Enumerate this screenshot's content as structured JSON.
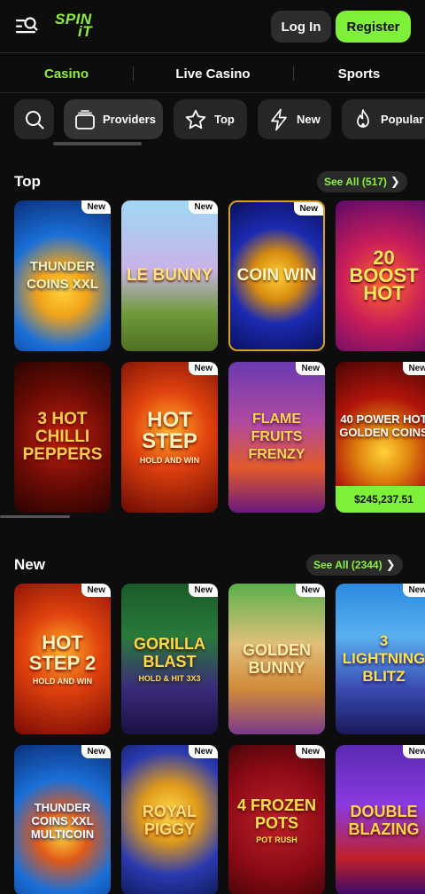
{
  "header": {
    "logo_line1": "SPIN",
    "logo_line2": "iT",
    "login_label": "Log In",
    "register_label": "Register"
  },
  "tabs": [
    {
      "label": "Casino",
      "active": true
    },
    {
      "label": "Live Casino",
      "active": false
    },
    {
      "label": "Sports",
      "active": false
    }
  ],
  "filters": [
    {
      "label": "Providers",
      "icon": "providers-icon"
    },
    {
      "label": "Top",
      "icon": "star-icon"
    },
    {
      "label": "New",
      "icon": "lightning-icon"
    },
    {
      "label": "Popular",
      "icon": "flame-icon"
    }
  ],
  "top_section": {
    "title": "Top",
    "see_all": "See All (517)",
    "games": [
      {
        "name": "Thunder Coins XXL",
        "badge": "New"
      },
      {
        "name": "Le Bunny",
        "badge": "New"
      },
      {
        "name": "Coin Win",
        "badge": "New"
      },
      {
        "name": "20 Boost Hot",
        "badge": ""
      },
      {
        "name": "3 Hot Chilli Peppers",
        "badge": ""
      },
      {
        "name": "Hot Step",
        "sub": "Hold and Win",
        "badge": "New"
      },
      {
        "name": "Flame Fruits Frenzy",
        "badge": "New"
      },
      {
        "name": "40 Power Hot Golden Coins",
        "badge": "New",
        "jackpot": "$245,237.51"
      }
    ]
  },
  "new_section": {
    "title": "New",
    "see_all": "See All (2344)",
    "games": [
      {
        "name": "Hot Step 2",
        "sub": "Hold and Win",
        "badge": "New"
      },
      {
        "name": "Gorilla Blast",
        "sub": "Hold & Hit 3x3",
        "badge": "New"
      },
      {
        "name": "Golden Bunny",
        "badge": "New"
      },
      {
        "name": "3 Lightning Blitz",
        "badge": "New"
      },
      {
        "name": "Thunder Coins XXL Multicoin",
        "badge": "New"
      },
      {
        "name": "Royal Piggy",
        "badge": "New"
      },
      {
        "name": "4 Frozen Pots",
        "sub": "Pot Rush",
        "badge": "New"
      },
      {
        "name": "Double Blazing",
        "badge": "New"
      }
    ]
  },
  "colors": {
    "accent": "#7ff03a",
    "background": "#0d0d0d",
    "chip": "#262626"
  }
}
